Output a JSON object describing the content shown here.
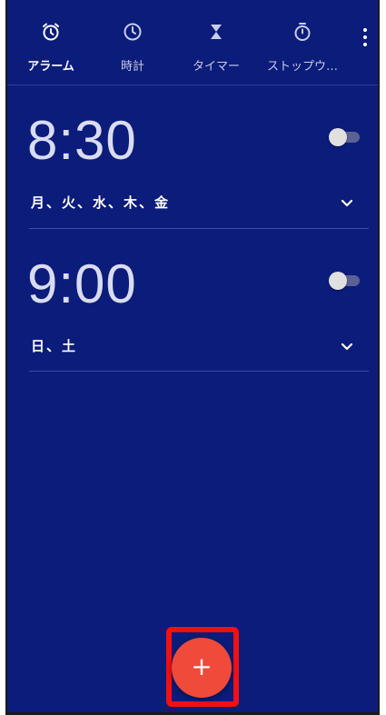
{
  "tabs": [
    {
      "label": "アラーム",
      "icon": "alarm-icon",
      "active": true
    },
    {
      "label": "時計",
      "icon": "clock-icon",
      "active": false
    },
    {
      "label": "タイマー",
      "icon": "hourglass-icon",
      "active": false
    },
    {
      "label": "ストップウ…",
      "icon": "stopwatch-icon",
      "active": false
    }
  ],
  "alarms": [
    {
      "time": "8:30",
      "days": "月、火、水、木、金",
      "enabled": false
    },
    {
      "time": "9:00",
      "days": "日、土",
      "enabled": false
    }
  ],
  "fab": {
    "label": "+",
    "icon": "add-icon"
  },
  "colors": {
    "background": "#0b1c7a",
    "accent": "#f04a3b",
    "highlight_box": "#f31010"
  }
}
